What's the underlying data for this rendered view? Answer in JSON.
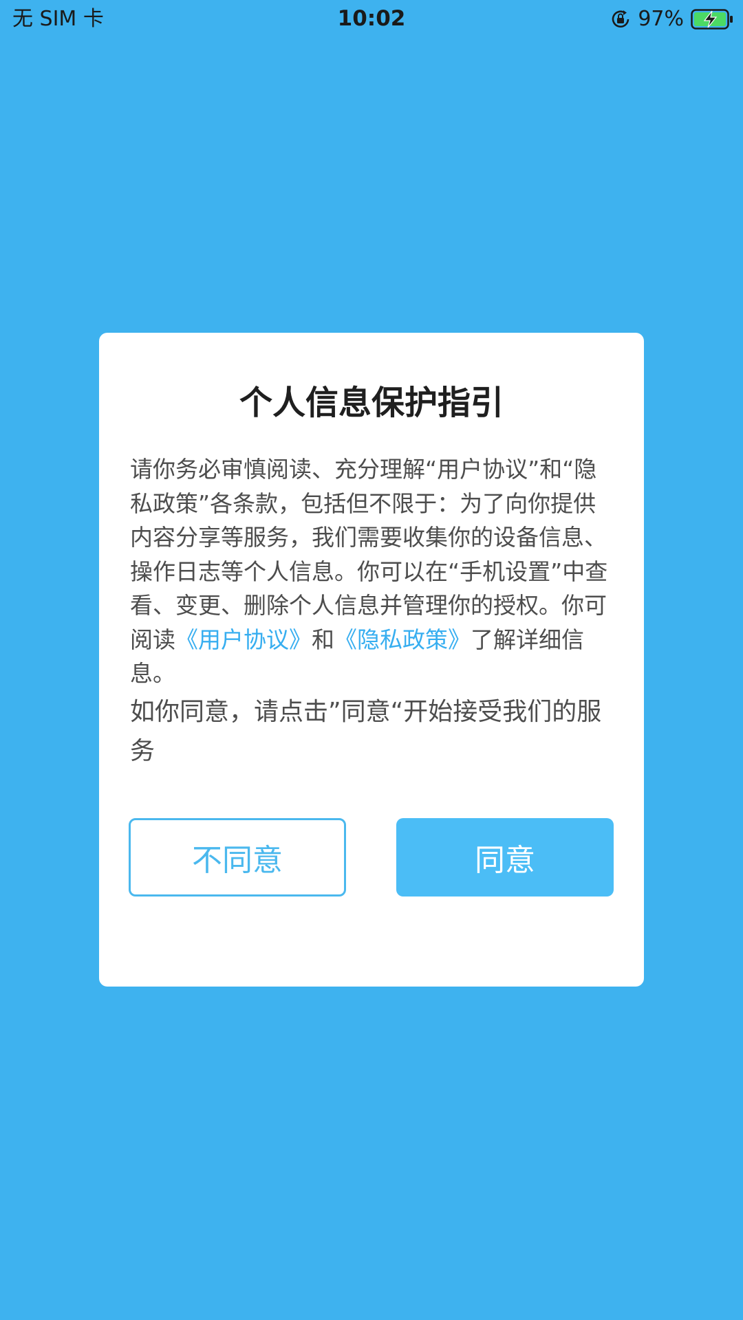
{
  "status_bar": {
    "carrier": "无 SIM 卡",
    "time": "10:02",
    "battery_percent": "97%",
    "icons": [
      "orientation-lock-icon",
      "battery-charging-icon"
    ]
  },
  "colors": {
    "background": "#3eb2ef",
    "link": "#37aef0",
    "button_primary": "#4bbdf6",
    "button_outline": "#4ab8ee"
  },
  "dialog": {
    "title": "个人信息保护指引",
    "body": {
      "intro": "请你务必审慎阅读、充分理解“用户协议”和“隐私政策”各条款，包括但不限于：为了向你提供内容分享等服务，我们需要收集你的设备信息、操作日志等个人信息。你可以在“手机设置”中查看、变更、删除个人信息并管理你的授权。你可阅读",
      "user_agreement_link": "《用户协议》",
      "and": "和",
      "privacy_policy_link": "《隐私政策》",
      "outro": "了解详细信息。",
      "consent": "如你同意，请点击”同意“开始接受我们的服务"
    },
    "buttons": {
      "disagree": "不同意",
      "agree": "同意"
    }
  }
}
